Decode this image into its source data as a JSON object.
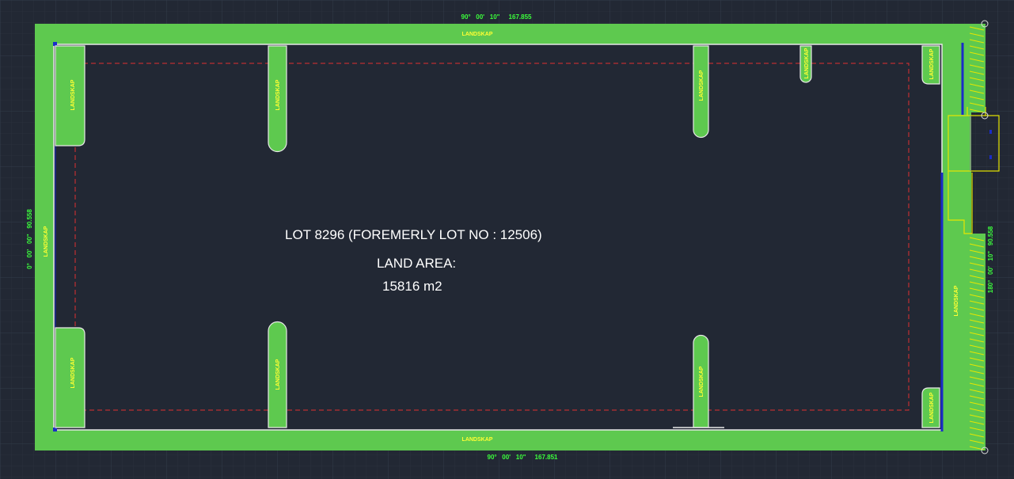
{
  "lot": {
    "title": "LOT 8296 (FOREMERLY LOT NO : 12506)",
    "area_label": "LAND AREA:",
    "area_value": "15816 m2"
  },
  "dimensions": {
    "top": "90°   00'   10\"     167.855",
    "bottom": "90°   00'   10\"     167.851",
    "left": "0°   00'   00\"   90.558",
    "right": "180°   00'   10\"   90.558"
  },
  "landscape_label": "LANDSKAP",
  "colors": {
    "background": "#222834",
    "grid": "#2f3644",
    "landscape_fill": "#5ec94f",
    "landscape_outline": "#e8e8e8",
    "setback_line": "#e03030",
    "road_edge": "#1a2cc8",
    "gate": "#e6e600",
    "dimension_text": "#3cff3c",
    "label_text": "#ffff33"
  }
}
